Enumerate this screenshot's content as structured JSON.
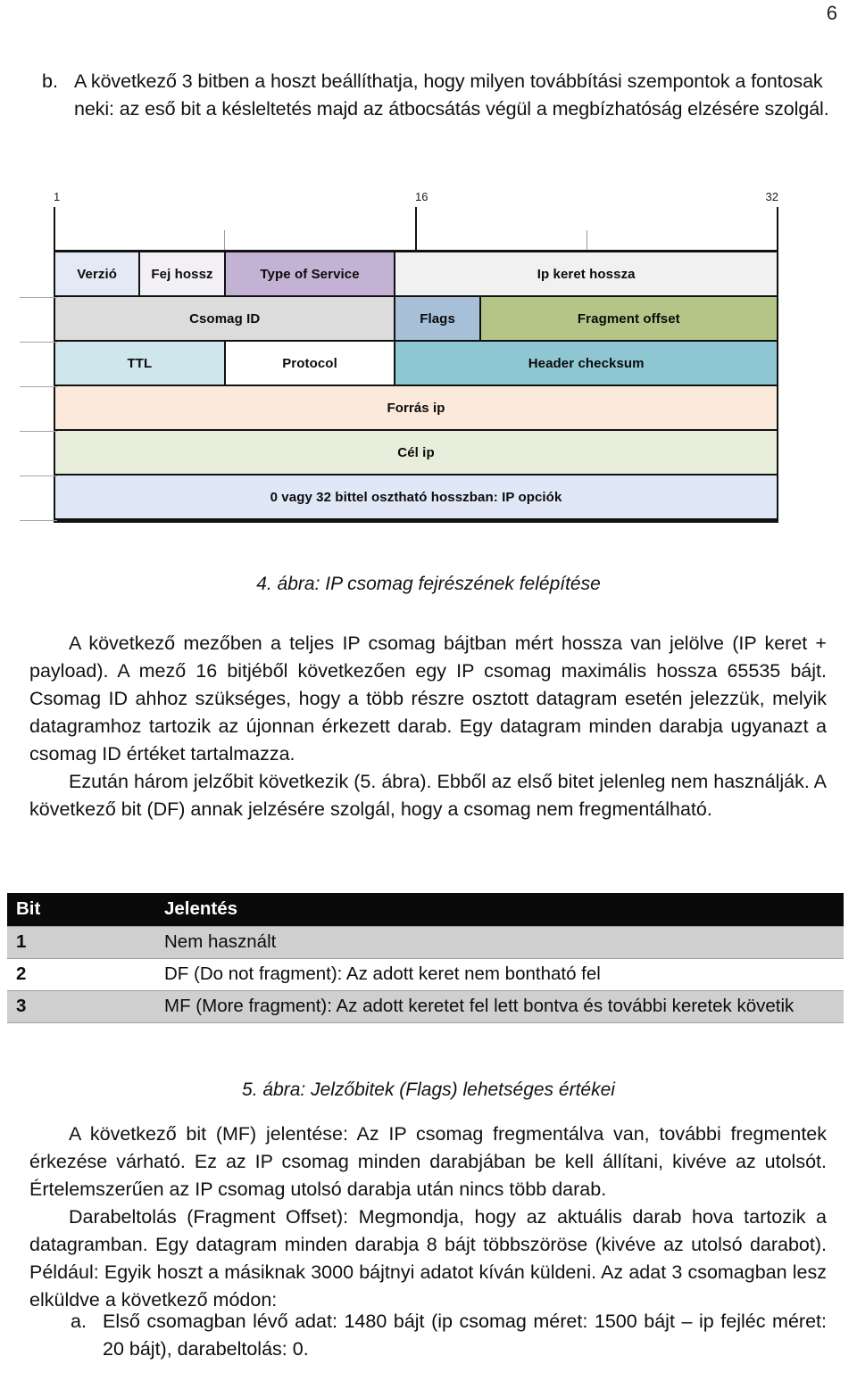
{
  "page": {
    "number": "6"
  },
  "intro_item": {
    "marker": "b.",
    "text": "A következő 3 bitben a hoszt beállíthatja, hogy milyen továbbítási szempontok a fontosak neki: az eső bit a késleltetés majd az átbocsátás végül a megbízhatóság elzésére szolgál."
  },
  "diagram": {
    "ruler": {
      "labels": [
        {
          "text": "1",
          "left_pct": 0
        },
        {
          "text": "16",
          "left_pct": 50
        },
        {
          "text": "32",
          "left_pct": 100
        }
      ]
    },
    "rows": [
      {
        "cells": [
          {
            "label": "Verzió",
            "width_pct": 11.8,
            "color": "#e4eaf5"
          },
          {
            "label": "Fej hossz",
            "width_pct": 11.8,
            "color": "#f2f0f4"
          },
          {
            "label": "Type of Service",
            "width_pct": 23.6,
            "color": "#c4b2d4"
          },
          {
            "label": "Ip keret hossza",
            "width_pct": 52.8,
            "color": "#f1f1f1"
          }
        ]
      },
      {
        "cells": [
          {
            "label": "Csomag ID",
            "width_pct": 47.2,
            "color": "#dcdcdc"
          },
          {
            "label": "Flags",
            "width_pct": 11.8,
            "color": "#a8bfd8"
          },
          {
            "label": "Fragment offset",
            "width_pct": 41.0,
            "color": "#b3c687"
          }
        ]
      },
      {
        "cells": [
          {
            "label": "TTL",
            "width_pct": 23.6,
            "color": "#cfe7ec"
          },
          {
            "label": "Protocol",
            "width_pct": 23.6,
            "color": "#ffffff"
          },
          {
            "label": "Header checksum",
            "width_pct": 52.8,
            "color": "#8ec7d2"
          }
        ]
      },
      {
        "cells": [
          {
            "label": "Forrás ip",
            "width_pct": 100,
            "color": "#fbe9dc"
          }
        ]
      },
      {
        "cells": [
          {
            "label": "Cél ip",
            "width_pct": 100,
            "color": "#e8eddc"
          }
        ]
      },
      {
        "cells": [
          {
            "label": "0 vagy 32 bittel osztható hosszban: IP opciók",
            "width_pct": 100,
            "color": "#e0e8f7"
          }
        ]
      }
    ]
  },
  "caption_4": "4. ábra: IP csomag fejrészének felépítése",
  "body_1": {
    "p1": "A következő mezőben a teljes IP csomag bájtban mért hossza van jelölve (IP keret + payload). A mező 16 bitjéből következően egy IP csomag maximális hossza 65535 bájt. Csomag ID ahhoz szükséges, hogy a több részre osztott datagram esetén jelezzük, melyik datagramhoz tartozik az újonnan érkezett darab. Egy datagram minden darabja ugyanazt a csomag ID értéket tartalmazza.",
    "p2": "Ezután három jelzőbit következik (5. ábra). Ebből az első bitet jelenleg nem használják. A következő bit (DF) annak jelzésére szolgál, hogy a csomag nem fregmentálható."
  },
  "flags_table": {
    "headers": [
      "Bit",
      "Jelentés"
    ],
    "rows": [
      {
        "bit": "1",
        "meaning": "Nem használt"
      },
      {
        "bit": "2",
        "meaning": "DF (Do not fragment): Az adott keret nem bontható fel"
      },
      {
        "bit": "3",
        "meaning": "MF (More fragment): Az adott keretet fel lett bontva és további keretek követik"
      }
    ]
  },
  "caption_5": "5. ábra: Jelzőbitek (Flags) lehetséges értékei",
  "body_2": {
    "p1": "A következő bit (MF) jelentése: Az IP csomag fregmentálva van, további fregmentek érkezése várható. Ez az IP csomag minden darabjában be kell állítani, kivéve az utolsót. Értelemszerűen az IP csomag utolsó darabja után nincs több darab.",
    "p2": "Darabeltolás (Fragment Offset): Megmondja, hogy az aktuális darab hova tartozik a datagramban. Egy datagram minden darabja 8 bájt többszöröse (kivéve az utolsó darabot). Például: Egyik hoszt a másiknak 3000 bájtnyi adatot kíván küldeni. Az adat 3 csomagban lesz elküldve a következő módon:"
  },
  "sub_item_a": {
    "marker": "a.",
    "text": "Első csomagban lévő adat: 1480 bájt (ip csomag méret: 1500 bájt – ip fejléc méret: 20 bájt), darabeltolás: 0."
  }
}
